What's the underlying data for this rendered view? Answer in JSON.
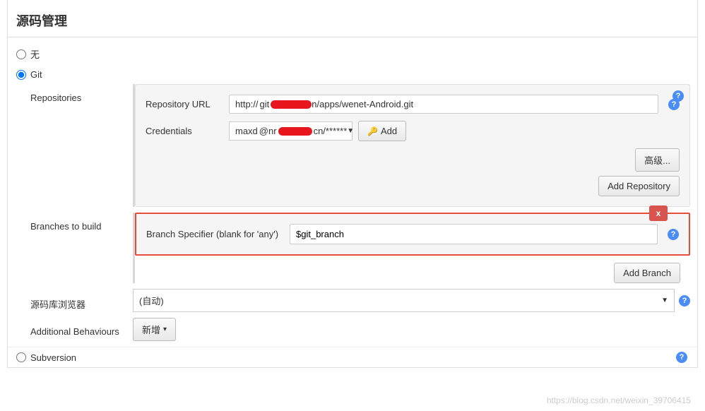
{
  "section": {
    "title": "源码管理"
  },
  "scm": {
    "none_label": "无",
    "git_label": "Git",
    "subversion_label": "Subversion",
    "selected": "git"
  },
  "repositories": {
    "label": "Repositories",
    "url_label": "Repository URL",
    "url_prefix": "http://",
    "url_suffix": "n/apps/wenet-Android.git",
    "credentials_label": "Credentials",
    "credentials_prefix": "maxd",
    "credentials_suffix": "cn/******",
    "add_button": "Add",
    "advanced_button": "高级...",
    "add_repo_button": "Add Repository"
  },
  "branches": {
    "label": "Branches to build",
    "specifier_label": "Branch Specifier (blank for 'any')",
    "specifier_value": "$git_branch",
    "add_branch_button": "Add Branch",
    "delete_label": "x"
  },
  "browser": {
    "label": "源码库浏览器",
    "value": "(自动)"
  },
  "behaviours": {
    "label": "Additional Behaviours",
    "add_button": "新增"
  },
  "watermark": "https://blog.csdn.net/weixin_39706415"
}
